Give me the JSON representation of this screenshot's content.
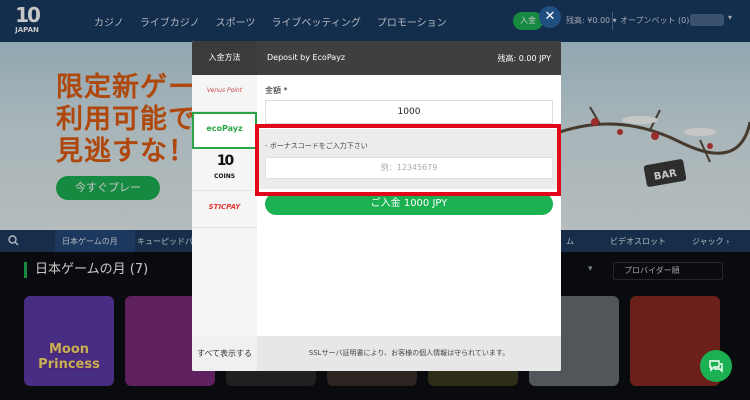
{
  "header": {
    "logo_main": "10",
    "logo_sub": "JAPAN",
    "nav": [
      "カジノ",
      "ライブカジノ",
      "スポーツ",
      "ライブベッティング",
      "プロモーション"
    ],
    "login_label": "入金",
    "balance": "残高: ¥0.00 ▾",
    "open_bets": "オープンベット (0)",
    "user_arrow": "▾"
  },
  "banner": {
    "headline_lines": [
      "限定新ゲー",
      "利用可能で",
      "見逃すな！"
    ],
    "cta_label": "今すぐプレー",
    "sign_text": "BAR"
  },
  "category_bar": {
    "items": [
      "日本ゲームの月",
      "キューピッドパ",
      "ム",
      "ビデオスロット",
      "ジャック ›"
    ]
  },
  "games_section": {
    "title": "日本ゲームの月 (7)",
    "provider_filter": "プロバイダー順",
    "dropdown_arrow": "▾",
    "tiles": [
      {
        "name": "Moon Princess",
        "color": "#5b3aa8"
      },
      {
        "name": "",
        "color": "#7a2a7a"
      },
      {
        "name": "",
        "color": "#2a2a2a"
      },
      {
        "name": "",
        "color": "#3a2e2a"
      },
      {
        "name": "",
        "color": "#3c3a1e"
      },
      {
        "name": "",
        "color": "#6a6e74"
      },
      {
        "name": "",
        "color": "#8a2a22"
      }
    ]
  },
  "modal": {
    "method_header": "入金方法",
    "methods": [
      {
        "label": "Venus Point",
        "color": "#c94444",
        "active": false
      },
      {
        "label": "ecoPayz",
        "color": "#2aa545",
        "active": true
      },
      {
        "label": "COINS",
        "color": "#111111",
        "active": false
      },
      {
        "label": "STICPAY",
        "color": "#e53935",
        "active": false
      }
    ],
    "coins_logo": "10",
    "show_all": "すべて表示する",
    "title": "Deposit by EcoPayz",
    "balance": "残高: 0.00 JPY",
    "amount_label": "金額 *",
    "amount_value": "1000",
    "bonus_label": "- ボーナスコードをご入力下さい",
    "bonus_placeholder": "例：12345679",
    "deposit_button": "ご入金 1000 JPY",
    "footer_note": "SSLサーバ証明書により、お客様の個人情報は守られています。",
    "close_symbol": "✕"
  },
  "colors": {
    "accent_green": "#1bb152",
    "highlight_red": "#e1081c",
    "header_navy": "#193a63"
  }
}
